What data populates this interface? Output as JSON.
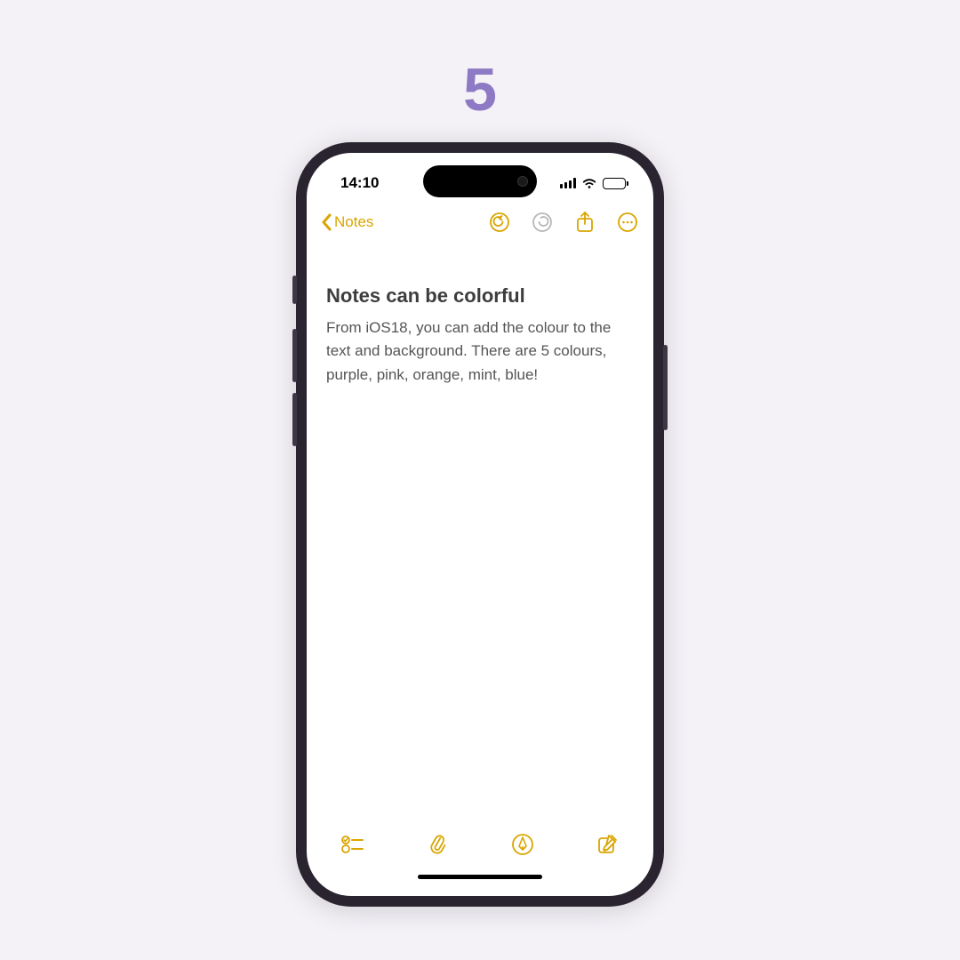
{
  "page_number": "5",
  "status": {
    "time": "14:10"
  },
  "nav": {
    "back_label": "Notes"
  },
  "note": {
    "title": "Notes can be colorful",
    "body": "From iOS18, you can add the colour to the text and background. There are 5 colours, purple, pink, orange, mint, blue!"
  },
  "colors": {
    "accent": "#d9a500",
    "page_number": "#8e79c4"
  }
}
